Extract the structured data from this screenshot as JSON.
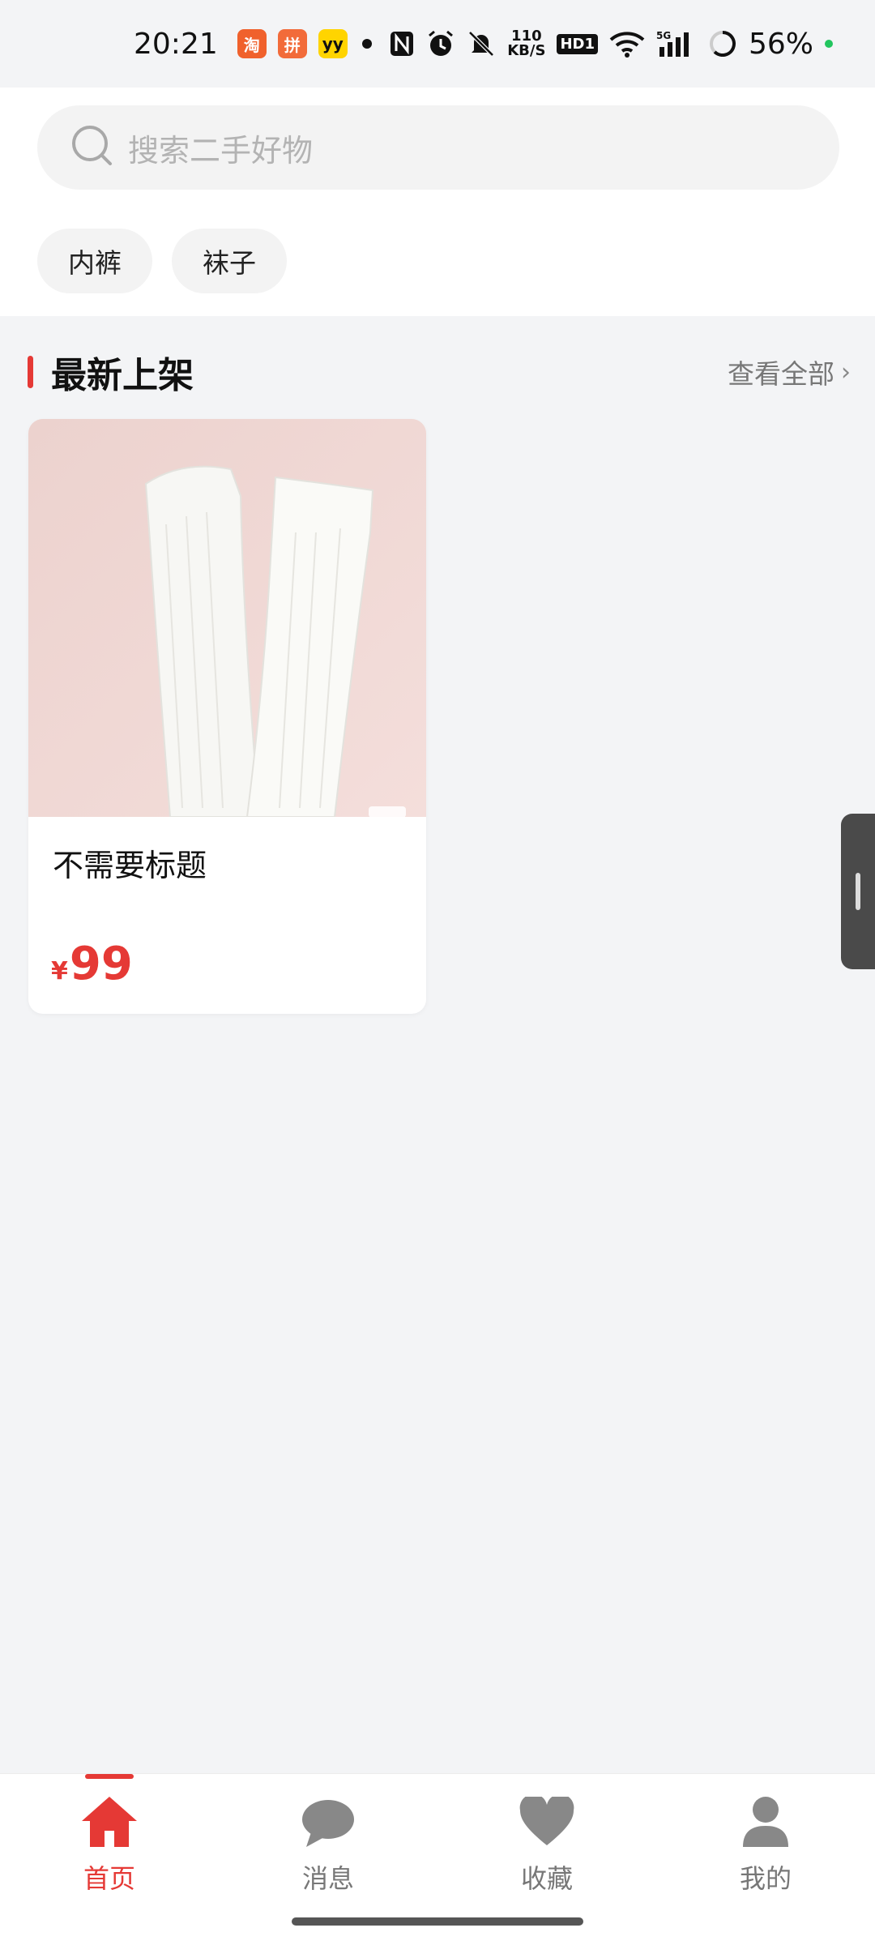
{
  "status_bar": {
    "time": "20:21",
    "speed_top": "110",
    "speed_bottom": "KB/S",
    "hd_label": "HD1",
    "network_label": "5G",
    "battery": "56%",
    "app_icons": [
      "taobao-icon",
      "pinduoduo-icon",
      "yy-icon"
    ]
  },
  "search": {
    "placeholder": "搜索二手好物"
  },
  "tags": [
    {
      "label": "内裤"
    },
    {
      "label": "袜子"
    }
  ],
  "section": {
    "title": "最新上架",
    "view_all": "查看全部",
    "view_all_chevron": "›"
  },
  "products": [
    {
      "title": "不需要标题",
      "price_symbol": "¥",
      "price": "99"
    }
  ],
  "nav": [
    {
      "label": "首页",
      "icon": "home-icon",
      "active": true
    },
    {
      "label": "消息",
      "icon": "chat-icon",
      "active": false
    },
    {
      "label": "收藏",
      "icon": "heart-icon",
      "active": false
    },
    {
      "label": "我的",
      "icon": "user-icon",
      "active": false
    }
  ],
  "colors": {
    "accent": "#e53935",
    "background": "#f3f4f6",
    "inactive": "#777777"
  }
}
